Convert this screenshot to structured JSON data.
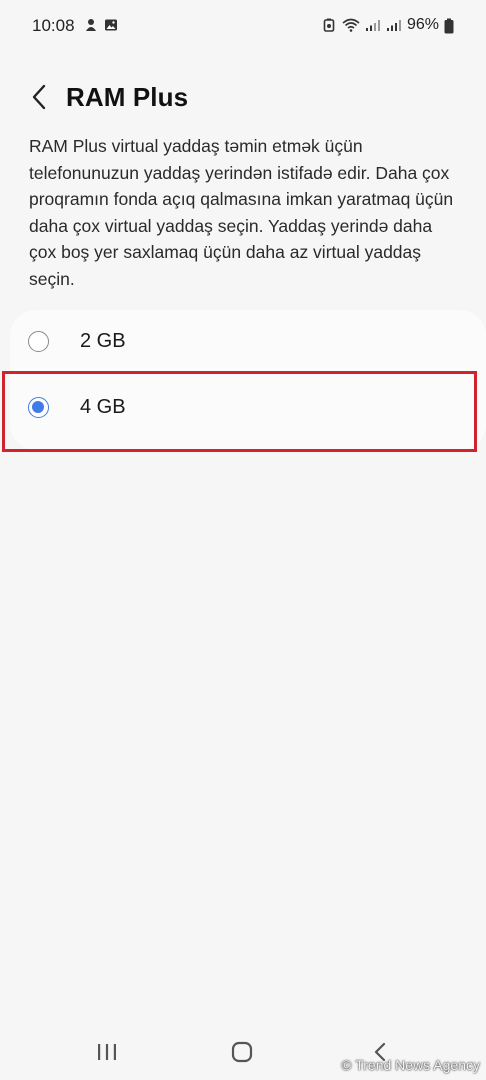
{
  "status_bar": {
    "time": "10:08",
    "battery_percent": "96%",
    "left_icons": [
      "notification-app-icon",
      "gallery-icon"
    ],
    "right_icons": [
      "battery-saver-icon",
      "wifi-icon",
      "signal-1-icon",
      "signal-2-icon",
      "battery-icon"
    ]
  },
  "header": {
    "title": "RAM Plus",
    "back_icon": "chevron-left-icon"
  },
  "description": "RAM Plus virtual yaddaş təmin etmək üçün telefonunuzun yaddaş yerindən istifadə edir. Daha çox proqramın fonda açıq qalmasına imkan yaratmaq üçün daha çox virtual yaddaş seçin. Yaddaş yerində daha çox boş yer saxlamaq üçün daha az virtual yaddaş seçin.",
  "options": [
    {
      "label": "2 GB",
      "selected": false
    },
    {
      "label": "4 GB",
      "selected": true
    }
  ],
  "colors": {
    "accent": "#3f7be9",
    "highlight": "#d0242c",
    "background": "#f6f6f6"
  },
  "nav_bar": {
    "icons": [
      "recents-icon",
      "home-icon",
      "back-icon"
    ]
  },
  "watermark": "© Trend News Agency"
}
